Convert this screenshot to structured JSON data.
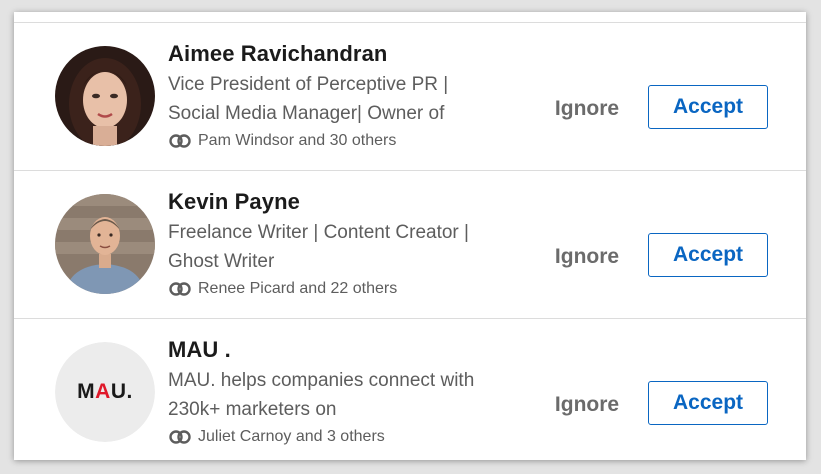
{
  "invitations": [
    {
      "name": "Aimee Ravichandran",
      "headline_line1": "Vice President of Perceptive PR |",
      "headline_line2": "Social Media Manager| Owner of",
      "mutual": "Pam Windsor and 30 others",
      "ignore_label": "Ignore",
      "accept_label": "Accept"
    },
    {
      "name": "Kevin Payne",
      "headline_line1": "Freelance Writer | Content Creator |",
      "headline_line2": "Ghost Writer",
      "mutual": "Renee Picard and 22 others",
      "ignore_label": "Ignore",
      "accept_label": "Accept"
    },
    {
      "name": "MAU .",
      "headline_line1": "MAU. helps companies connect with",
      "headline_line2": "230k+ marketers on",
      "mutual": "Juliet Carnoy and 3 others",
      "ignore_label": "Ignore",
      "accept_label": "Accept",
      "logo_text_a": "M",
      "logo_text_b": "A",
      "logo_text_c": "U."
    }
  ],
  "colors": {
    "accent": "#0a66c2",
    "text_primary": "#1b1b1b",
    "text_secondary": "#5d5d5d",
    "logo_red": "#e0192a"
  },
  "icons": {
    "mutual": "mutual-connections-icon"
  }
}
